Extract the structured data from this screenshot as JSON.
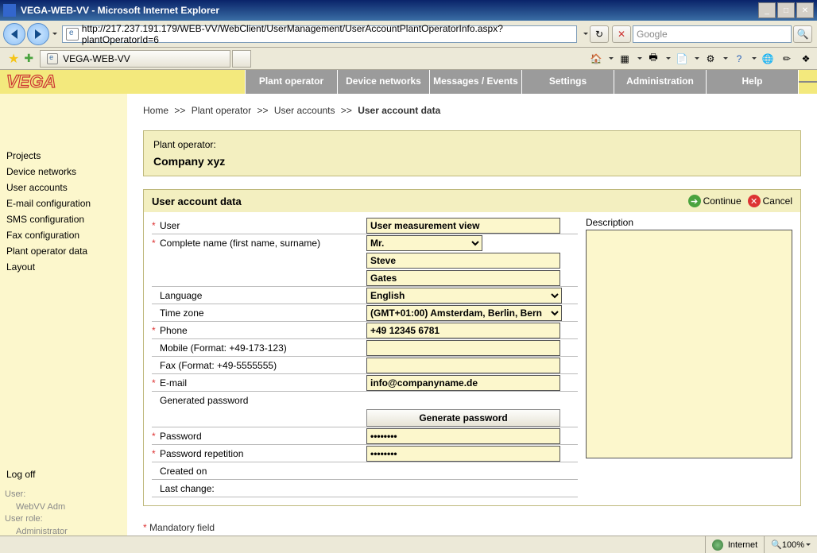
{
  "window": {
    "title": "VEGA-WEB-VV - Microsoft Internet Explorer"
  },
  "address": {
    "url": "http://217.237.191.179/WEB-VV/WebClient/UserManagement/UserAccountPlantOperatorInfo.aspx?plantOperatorId=6"
  },
  "search": {
    "placeholder": "Google"
  },
  "tab": {
    "title": "VEGA-WEB-VV"
  },
  "nav": {
    "plant_operator": "Plant operator",
    "device_networks": "Device networks",
    "messages_events": "Messages / Events",
    "settings": "Settings",
    "administration": "Administration",
    "help": "Help"
  },
  "sidebar": {
    "items": [
      "Projects",
      "Device networks",
      "User accounts",
      "E-mail configuration",
      "SMS configuration",
      "Fax configuration",
      "Plant operator data",
      "Layout"
    ],
    "logoff": "Log off",
    "user_label": "User:",
    "user_value": "WebVV Adm",
    "role_label": "User role:",
    "role_value": "Administrator"
  },
  "breadcrumb": {
    "home": "Home",
    "po": "Plant operator",
    "ua": "User accounts",
    "current": "User account data"
  },
  "panel": {
    "label": "Plant operator:",
    "company": "Company xyz"
  },
  "section": {
    "title": "User account data",
    "continue": "Continue",
    "cancel": "Cancel",
    "description_label": "Description"
  },
  "form": {
    "user_label": "User",
    "user_value": "User measurement view",
    "name_label": "Complete name (first name, surname)",
    "salutation": "Mr.",
    "first_name": "Steve",
    "surname": "Gates",
    "language_label": "Language",
    "language_value": "English",
    "timezone_label": "Time zone",
    "timezone_value": "(GMT+01:00) Amsterdam, Berlin, Bern",
    "phone_label": "Phone",
    "phone_value": "+49 12345 6781",
    "mobile_label": "Mobile (Format: +49-173-123)",
    "mobile_value": "",
    "fax_label": "Fax (Format: +49-5555555)",
    "fax_value": "",
    "email_label": "E-mail",
    "email_value": "info@companyname.de",
    "genpw_label": "Generated password",
    "genpw_btn": "Generate password",
    "pw_label": "Password",
    "pw_value": "••••••••",
    "pwr_label": "Password repetition",
    "pwr_value": "••••••••",
    "created_label": "Created on",
    "created_value": "",
    "lastchange_label": "Last change:",
    "lastchange_value": ""
  },
  "mandatory": "Mandatory field",
  "status": {
    "zone": "Internet",
    "zoom": "100%"
  }
}
